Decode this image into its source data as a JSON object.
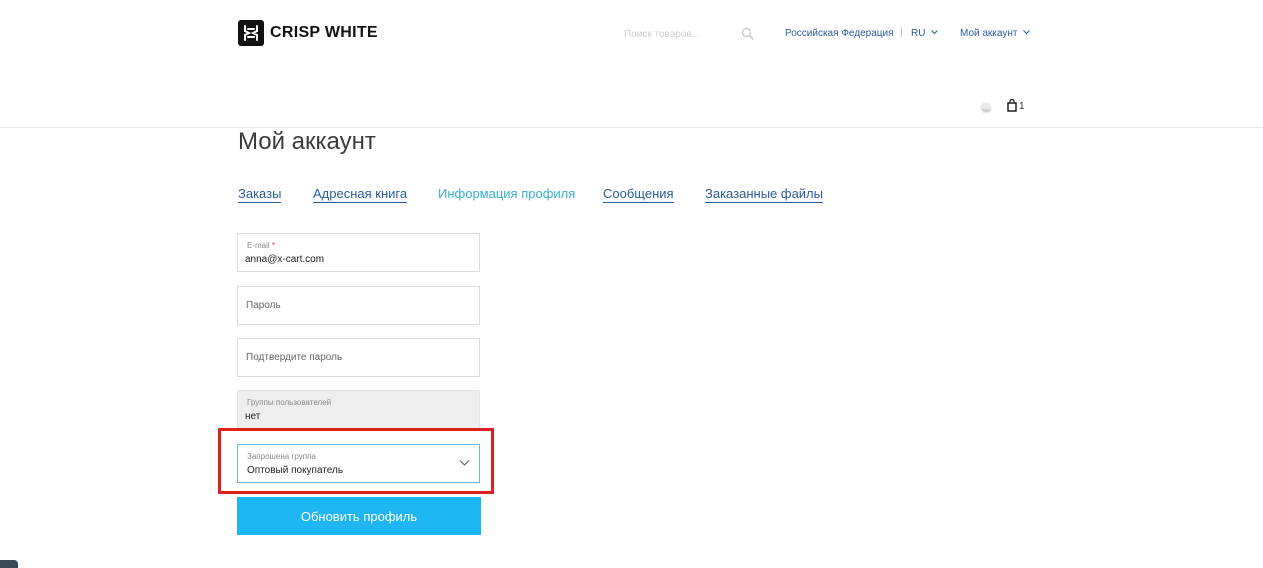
{
  "header": {
    "brand": "CRISP WHITE",
    "search_placeholder": "Поиск товаров...",
    "country": "Российская Федерация",
    "separator": "|",
    "language": "RU",
    "account_menu": "Мой аккаунт",
    "cart_count": "1"
  },
  "page": {
    "title": "Мой аккаунт",
    "tabs": [
      {
        "label": "Заказы",
        "active": false
      },
      {
        "label": "Адресная книга",
        "active": false
      },
      {
        "label": "Информация профиля",
        "active": true
      },
      {
        "label": "Сообщения",
        "active": false
      },
      {
        "label": "Заказанные файлы",
        "active": false
      }
    ]
  },
  "form": {
    "email_label": "E-mail",
    "email_required_mark": "*",
    "email_value": "anna@x-cart.com",
    "password_placeholder": "Пароль",
    "confirm_placeholder": "Подтвердите пароль",
    "groups_label": "Группы пользователей",
    "groups_value": "нет",
    "requested_group_label": "Запрошена группа",
    "requested_group_value": "Оптовый покупатель",
    "submit_label": "Обновить профиль"
  },
  "colors": {
    "link": "#2b5c9a",
    "active_tab": "#35b2c7",
    "button": "#1eb6f2",
    "highlight": "#e02020"
  }
}
